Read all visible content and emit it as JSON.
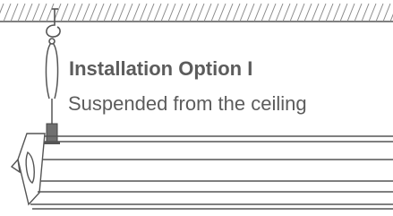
{
  "figure": {
    "title": "Installation Option I",
    "subtitle": "Suspended from the ceiling"
  },
  "colors": {
    "text": "#5c5c5c",
    "line": "#555555",
    "hatch": "#8a8a8a"
  },
  "icons": [
    "ceiling-hatch-icon",
    "hook-icon",
    "suspension-cable-icon",
    "cable-gripper-icon",
    "linear-light-fixture-icon"
  ]
}
